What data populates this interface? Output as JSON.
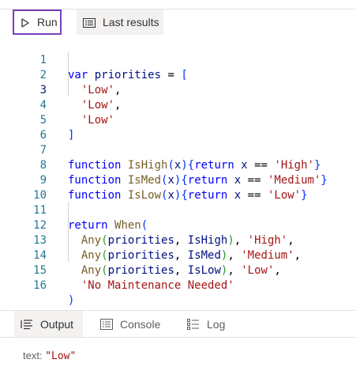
{
  "toolbar": {
    "run_label": "Run",
    "run_icon": "play-icon",
    "results_label": "Last results",
    "results_icon": "list-icon"
  },
  "editor": {
    "lines": [
      {
        "num": "1"
      },
      {
        "num": "2"
      },
      {
        "num": "3"
      },
      {
        "num": "4"
      },
      {
        "num": "5"
      },
      {
        "num": "6"
      },
      {
        "num": "7"
      },
      {
        "num": "8"
      },
      {
        "num": "9"
      },
      {
        "num": "10"
      },
      {
        "num": "11"
      },
      {
        "num": "12"
      },
      {
        "num": "13"
      },
      {
        "num": "14"
      },
      {
        "num": "15"
      },
      {
        "num": "16"
      }
    ],
    "tokens": {
      "var": "var",
      "priorities": "priorities",
      "eq": "=",
      "lbracket": "[",
      "rbracket": "]",
      "low": "'Low'",
      "comma": ",",
      "function": "function",
      "ishigh": "IsHigh",
      "ismed": "IsMed",
      "islow": "IsLow",
      "x": "x",
      "return": "return",
      "eqeq": "==",
      "high": "'High'",
      "medium": "'Medium'",
      "when": "When",
      "any": "Any",
      "none": "'No Maintenance Needed'"
    }
  },
  "bottom": {
    "tabs": [
      {
        "label": "Output",
        "icon": "output-list-icon"
      },
      {
        "label": "Console",
        "icon": "console-icon"
      },
      {
        "label": "Log",
        "icon": "log-icon"
      }
    ],
    "output": {
      "key": "text:",
      "value": "\"Low\""
    }
  },
  "colors": {
    "accent": "#7a3fbf",
    "keyword": "#0000ff",
    "string": "#a31515",
    "function": "#795e26",
    "identifier": "#001080",
    "line_number": "#237893"
  }
}
